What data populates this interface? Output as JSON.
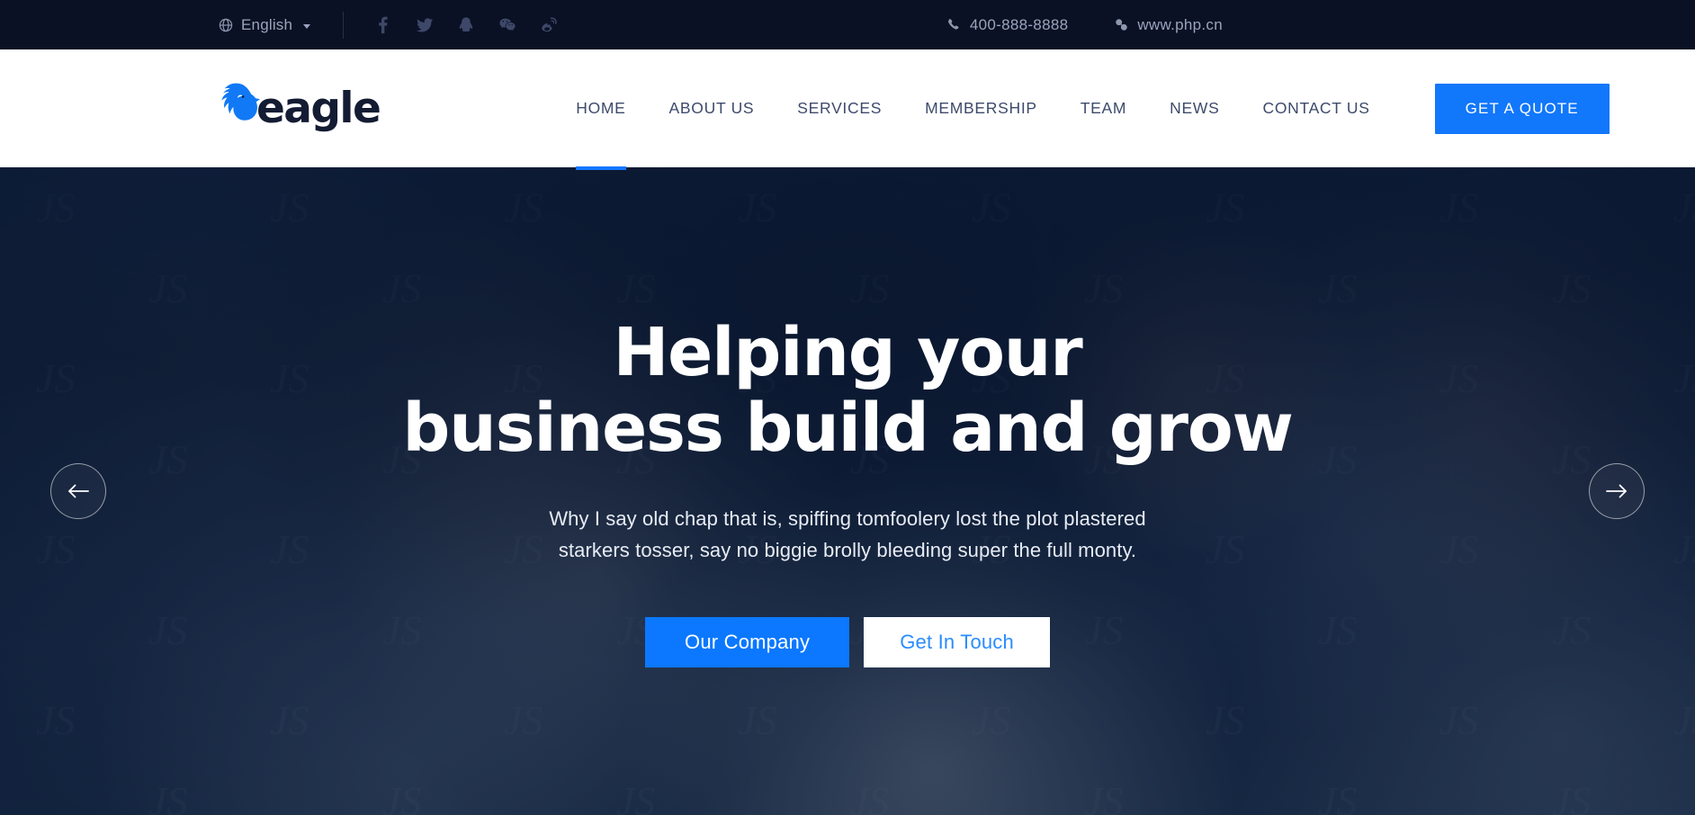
{
  "topbar": {
    "language": {
      "label": "English",
      "icon": "globe-icon",
      "caret": "chevron-down-icon"
    },
    "socials": [
      {
        "name": "facebook-icon",
        "label": "Facebook"
      },
      {
        "name": "twitter-icon",
        "label": "Twitter"
      },
      {
        "name": "qq-icon",
        "label": "QQ"
      },
      {
        "name": "wechat-icon",
        "label": "WeChat"
      },
      {
        "name": "weibo-icon",
        "label": "Weibo"
      }
    ],
    "phone": {
      "icon": "phone-icon",
      "value": "400-888-8888"
    },
    "website": {
      "icon": "link-icon",
      "value": "www.php.cn"
    }
  },
  "header": {
    "logo": {
      "icon": "eagle-head-icon",
      "wordmark": "eagle"
    },
    "nav": [
      {
        "label": "HOME",
        "active": true
      },
      {
        "label": "ABOUT US",
        "active": false
      },
      {
        "label": "SERVICES",
        "active": false
      },
      {
        "label": "MEMBERSHIP",
        "active": false
      },
      {
        "label": "TEAM",
        "active": false
      },
      {
        "label": "NEWS",
        "active": false
      },
      {
        "label": "CONTACT US",
        "active": false
      }
    ],
    "quote_button": "GET A QUOTE"
  },
  "hero": {
    "title_line1": "Helping your",
    "title_line2": "business build and grow",
    "subtitle_line1": "Why I say old chap that is, spiffing tomfoolery lost the plot plastered",
    "subtitle_line2": "starkers tosser, say no biggie brolly bleeding super the full monty.",
    "primary_button": "Our Company",
    "secondary_button": "Get In Touch",
    "prev_arrow": "arrow-left-icon",
    "next_arrow": "arrow-right-icon",
    "watermark_text": "JS"
  },
  "colors": {
    "topbar_bg": "#0a1124",
    "topbar_text": "#9aa4bd",
    "header_bg": "#ffffff",
    "nav_text": "#3d4a6b",
    "accent_blue": "#1177fb",
    "hero_button_blue": "#0b78ff",
    "hero_overlay": "#0b1a36",
    "logo_blue": "#1179f5",
    "logo_text": "#141c33"
  }
}
